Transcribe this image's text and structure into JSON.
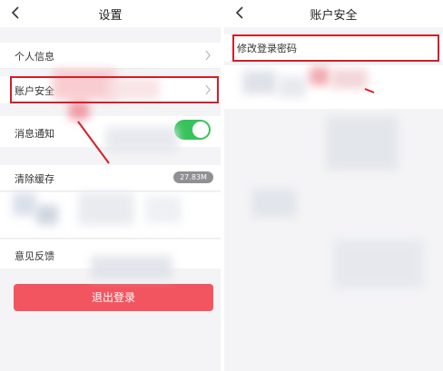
{
  "left_screen": {
    "title": "设置",
    "menu": [
      {
        "label": "个人信息"
      },
      {
        "label": "账户安全"
      },
      {
        "label": "消息通知"
      },
      {
        "label": "清除缓存",
        "badge": "27.83M"
      },
      {
        "label": "意见反馈"
      }
    ],
    "logout_label": "退出登录"
  },
  "right_screen": {
    "title": "账户安全",
    "first_item_label": "修改登录密码"
  },
  "colors": {
    "highlight": "#d61d28",
    "logout_button": "#f2555f",
    "toggle_on": "#35c35a",
    "badge": "#8f8f94"
  },
  "icons": [
    "back-chevron-icon",
    "chevron-right-icon"
  ]
}
